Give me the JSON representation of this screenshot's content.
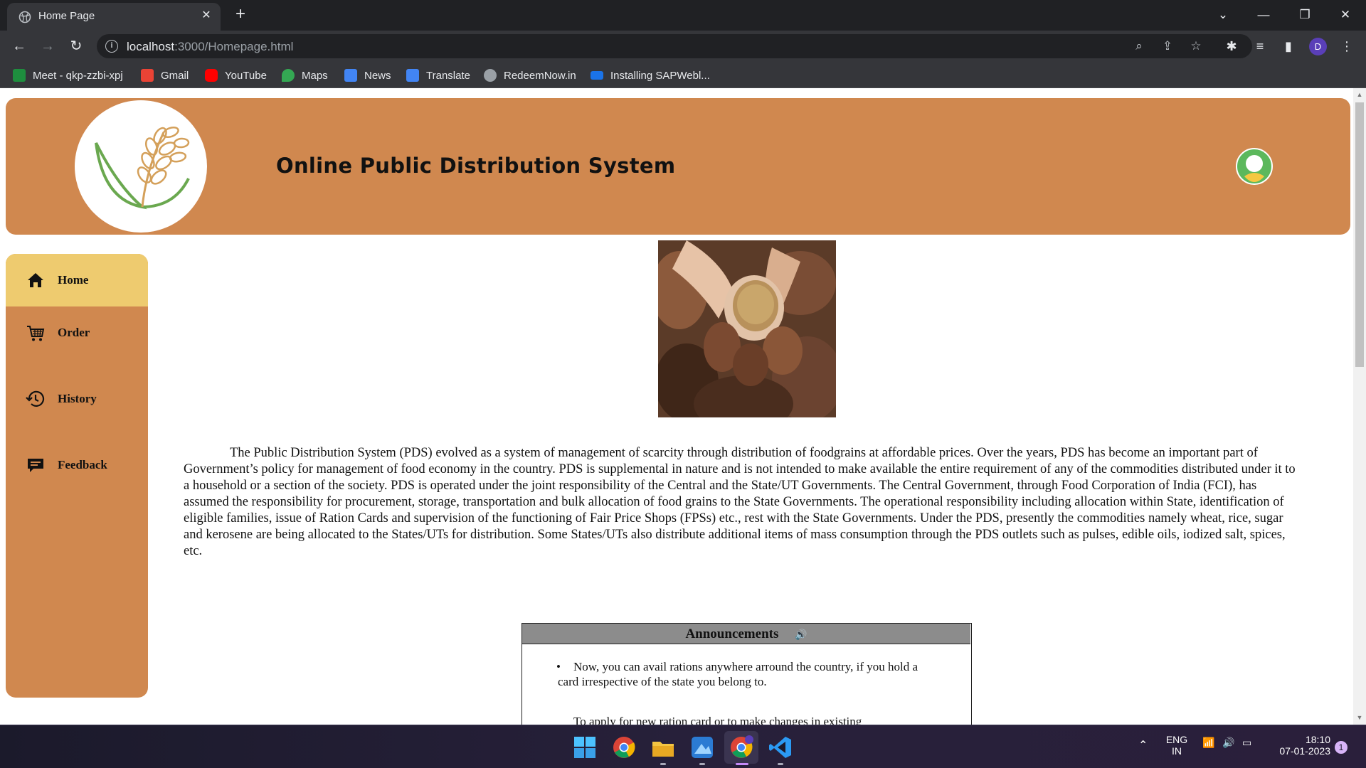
{
  "browser": {
    "tab_title": "Home Page",
    "tab_close": "✕",
    "new_tab": "+",
    "url_host": "localhost",
    "url_path": ":3000/Homepage.html",
    "bookmarks": [
      {
        "label": "Meet - qkp-zzbi-xpj",
        "icon": "google-meet-icon",
        "color": "#1e8e3e"
      },
      {
        "label": "Gmail",
        "icon": "gmail-icon",
        "color": "#ea4335"
      },
      {
        "label": "YouTube",
        "icon": "youtube-icon",
        "color": "#ff0000"
      },
      {
        "label": "Maps",
        "icon": "maps-icon",
        "color": "#34a853"
      },
      {
        "label": "News",
        "icon": "news-icon",
        "color": "#4285f4"
      },
      {
        "label": "Translate",
        "icon": "translate-icon",
        "color": "#4285f4"
      },
      {
        "label": "RedeemNow.in",
        "icon": "globe-icon",
        "color": "#9aa0a6"
      },
      {
        "label": "Installing SAPWebl...",
        "icon": "sap-icon",
        "color": "#1a73e8"
      }
    ],
    "profile_initial": "D"
  },
  "header": {
    "title": "Online Public Distribution System",
    "brand_color": "#d0884f"
  },
  "sidebar": {
    "items": [
      {
        "label": "Home",
        "icon": "home-icon",
        "active": true
      },
      {
        "label": "Order",
        "icon": "cart-icon",
        "active": false
      },
      {
        "label": "History",
        "icon": "history-icon",
        "active": false
      },
      {
        "label": "Feedback",
        "icon": "feedback-icon",
        "active": false
      }
    ],
    "active_color": "#eecb6f"
  },
  "main": {
    "description": "The Public Distribution System (PDS) evolved as a system of management of scarcity through distribution of foodgrains at affordable prices. Over the years, PDS has become an important part of Government’s policy for management of food economy in the country. PDS is supplemental in nature and is not intended to make available the entire requirement of any of the commodities distributed under it to a household or a section of the society. PDS is operated under the joint responsibility of the Central and the State/UT Governments. The Central Government, through Food Corporation of India (FCI), has assumed the responsibility for procurement, storage, transportation and bulk allocation of food grains to the State Governments. The operational responsibility including allocation within State, identification of eligible families, issue of Ration Cards and supervision of the functioning of Fair Price Shops (FPSs) etc., rest with the State Governments. Under the PDS, presently the commodities namely wheat, rice, sugar and kerosene are being allocated to the States/UTs for distribution. Some States/UTs also distribute additional items of mass consumption through the PDS outlets such as pulses, edible oils, iodized salt, spices, etc.",
    "announcements": {
      "heading": "Announcements",
      "items": [
        "Now, you can avail rations anywhere arround the country, if you hold a card irrespective of the state you belong to.",
        "To apply for new ration card or to make changes in existing"
      ]
    }
  },
  "taskbar": {
    "language_top": "ENG",
    "language_bottom": "IN",
    "time": "18:10",
    "date": "07-01-2023",
    "notification_count": "1"
  }
}
